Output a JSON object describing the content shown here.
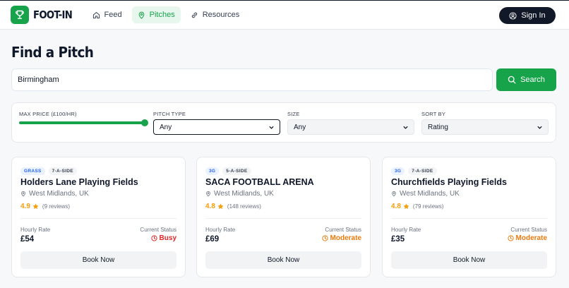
{
  "app": {
    "name": "FOOT-IN"
  },
  "nav": [
    {
      "label": "Feed",
      "icon": "home-icon"
    },
    {
      "label": "Pitches",
      "icon": "map-pin-icon",
      "active": true
    },
    {
      "label": "Resources",
      "icon": "link-icon"
    }
  ],
  "header": {
    "signin_label": "Sign In"
  },
  "page": {
    "title": "Find a Pitch"
  },
  "search": {
    "value": "Birmingham",
    "button_label": "Search"
  },
  "filters": {
    "max_price": {
      "label": "MAX PRICE (£100/HR)",
      "fraction": 1.0
    },
    "pitch_type": {
      "label": "PITCH TYPE",
      "value": "Any"
    },
    "size": {
      "label": "SIZE",
      "value": "Any"
    },
    "sort_by": {
      "label": "SORT BY",
      "value": "Rating"
    }
  },
  "cards": [
    {
      "surface": "GRASS",
      "size": "7-A-SIDE",
      "name": "Holders Lane Playing Fields",
      "location": "West Midlands, UK",
      "rating": "4.9",
      "reviews": "(9 reviews)",
      "rate_label": "Hourly Rate",
      "rate": "£54",
      "status_label": "Current Status",
      "status": "Busy",
      "status_color": "#dc2626",
      "book_label": "Book Now"
    },
    {
      "surface": "3G",
      "size": "5-A-SIDE",
      "name": "SACA FOOTBALL ARENA",
      "location": "West Midlands, UK",
      "rating": "4.8",
      "reviews": "(148 reviews)",
      "rate_label": "Hourly Rate",
      "rate": "£69",
      "status_label": "Current Status",
      "status": "Moderate",
      "status_color": "#ea7a0c",
      "book_label": "Book Now"
    },
    {
      "surface": "3G",
      "size": "7-A-SIDE",
      "name": "Churchfields Playing Fields",
      "location": "West Midlands, UK",
      "rating": "4.8",
      "reviews": "(79 reviews)",
      "rate_label": "Hourly Rate",
      "rate": "£35",
      "status_label": "Current Status",
      "status": "Moderate",
      "status_color": "#ea7a0c",
      "book_label": "Book Now"
    }
  ],
  "colors": {
    "brand": "#16a34a",
    "dark": "#111827",
    "star": "#f59e0b"
  }
}
